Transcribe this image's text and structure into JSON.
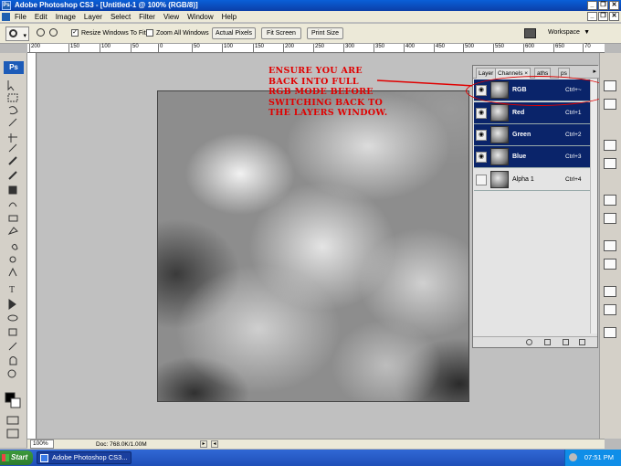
{
  "window": {
    "title": "Adobe Photoshop CS3 - [Untitled-1 @ 100% (RGB/8)]",
    "app_icon": "Ps"
  },
  "menu": [
    "File",
    "Edit",
    "Image",
    "Layer",
    "Select",
    "Filter",
    "View",
    "Window",
    "Help"
  ],
  "options": {
    "resize_windows": "Resize Windows To Fit",
    "zoom_all": "Zoom All Windows",
    "actual_pixels": "Actual Pixels",
    "fit_screen": "Fit Screen",
    "print_size": "Print Size",
    "workspace": "Workspace"
  },
  "ruler_labels": [
    "200",
    "150",
    "100",
    "50",
    "0",
    "50",
    "100",
    "150",
    "200",
    "250",
    "300",
    "350",
    "400",
    "450",
    "500",
    "550",
    "600",
    "650",
    "70"
  ],
  "tools": {
    "logo": "Ps"
  },
  "annotation": [
    "ENSURE YOU ARE",
    "BACK INTO FULL",
    "RGB MODE BEFORE",
    "SWITCHING BACK TO",
    "THE LAYERS WINDOW."
  ],
  "panel": {
    "tabs": [
      "Layer",
      "Channels",
      "aths",
      "ps"
    ],
    "channels": [
      {
        "name": "RGB",
        "shortcut": "Ctrl+~",
        "selected": true,
        "visible": true
      },
      {
        "name": "Red",
        "shortcut": "Ctrl+1",
        "selected": true,
        "visible": true
      },
      {
        "name": "Green",
        "shortcut": "Ctrl+2",
        "selected": true,
        "visible": true
      },
      {
        "name": "Blue",
        "shortcut": "Ctrl+3",
        "selected": true,
        "visible": true
      },
      {
        "name": "Alpha 1",
        "shortcut": "Ctrl+4",
        "selected": false,
        "visible": false
      }
    ]
  },
  "status": {
    "zoom": "100%",
    "doc": "Doc: 768.0K/1.00M"
  },
  "taskbar": {
    "start": "Start",
    "task": "Adobe Photoshop CS3...",
    "clock": "07:51 PM"
  },
  "colors": {
    "annotation": "#e00000",
    "selection": "#0a246a",
    "titlebar": "#0a5fd8"
  }
}
